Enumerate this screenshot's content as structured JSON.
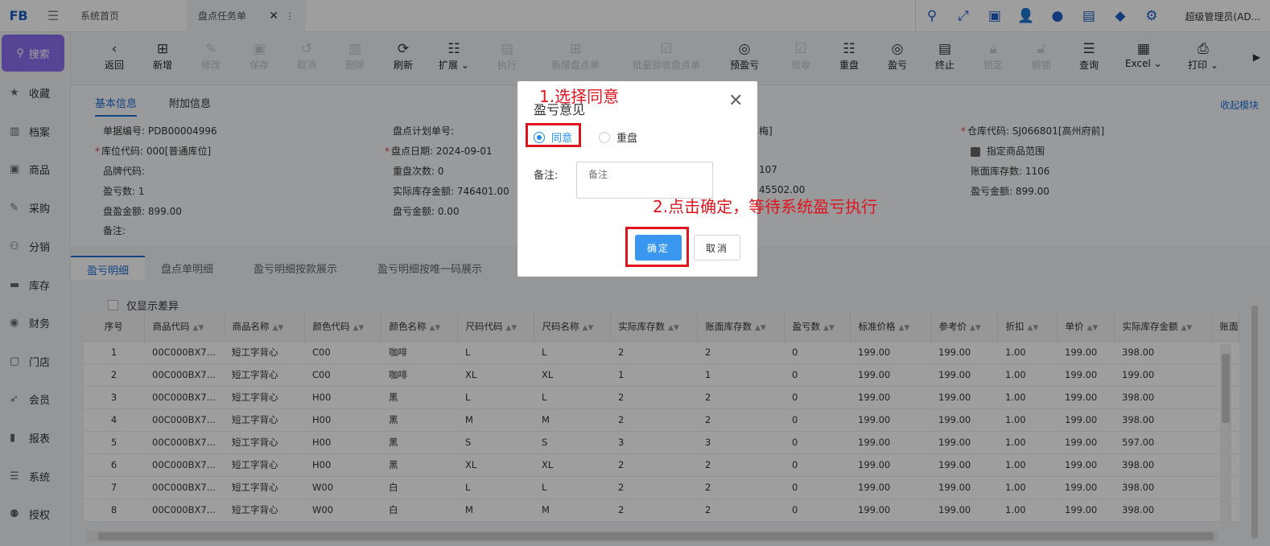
{
  "app": {
    "logo": "FB",
    "tabs": [
      {
        "label": "系统首页"
      },
      {
        "label": "盘点任务单"
      }
    ],
    "user": "超级管理员(AD..."
  },
  "sidebar": {
    "search_label": "搜索",
    "items": [
      {
        "label": "收藏",
        "icon": "star-icon"
      },
      {
        "label": "档案",
        "icon": "archive-icon"
      },
      {
        "label": "商品",
        "icon": "goods-icon"
      },
      {
        "label": "采购",
        "icon": "purchase-icon"
      },
      {
        "label": "分销",
        "icon": "distribution-icon"
      },
      {
        "label": "库存",
        "icon": "inventory-icon"
      },
      {
        "label": "财务",
        "icon": "finance-icon"
      },
      {
        "label": "门店",
        "icon": "store-icon"
      },
      {
        "label": "会员",
        "icon": "member-icon"
      },
      {
        "label": "报表",
        "icon": "report-icon"
      },
      {
        "label": "系统",
        "icon": "system-icon"
      },
      {
        "label": "授权",
        "icon": "license-icon"
      }
    ]
  },
  "toolbar": {
    "buttons": [
      {
        "label": "返回",
        "icon": "back-icon",
        "enabled": true
      },
      {
        "label": "新增",
        "icon": "add-icon",
        "enabled": true
      },
      {
        "label": "修改",
        "icon": "edit-icon",
        "enabled": false
      },
      {
        "label": "保存",
        "icon": "save-icon",
        "enabled": false
      },
      {
        "label": "取消",
        "icon": "undo-icon",
        "enabled": false
      },
      {
        "label": "删除",
        "icon": "delete-icon",
        "enabled": false
      },
      {
        "label": "刷新",
        "icon": "refresh-icon",
        "enabled": true
      },
      {
        "label": "扩展",
        "icon": "extend-icon",
        "enabled": true
      },
      {
        "label": "执行",
        "icon": "execute-icon",
        "enabled": false
      },
      {
        "label": "新增盘点单",
        "icon": "add-count-icon",
        "enabled": false
      },
      {
        "label": "批量验收盘点单",
        "icon": "batch-check-icon",
        "enabled": false
      },
      {
        "label": "预盈亏",
        "icon": "pre-profit-icon",
        "enabled": true
      },
      {
        "label": "验收",
        "icon": "accept-icon",
        "enabled": false
      },
      {
        "label": "重盘",
        "icon": "recount-icon",
        "enabled": true
      },
      {
        "label": "盈亏",
        "icon": "profit-loss-icon",
        "enabled": true
      },
      {
        "label": "终止",
        "icon": "terminate-icon",
        "enabled": true
      },
      {
        "label": "锁定",
        "icon": "lock-icon",
        "enabled": false
      },
      {
        "label": "解锁",
        "icon": "unlock-icon",
        "enabled": false
      },
      {
        "label": "查询",
        "icon": "query-icon",
        "enabled": true
      },
      {
        "label": "Excel",
        "icon": "excel-icon",
        "enabled": true
      },
      {
        "label": "打印",
        "icon": "print-icon",
        "enabled": true
      }
    ]
  },
  "form": {
    "tabs": [
      "基本信息",
      "附加信息"
    ],
    "collapse_label": "收起模块",
    "fields": {
      "doc_no": "单据编号:  PDB00004996",
      "plan_no": "盘点计划单号:",
      "col3_row1": "梅]",
      "warehouse": "仓库代码:  SJ066801[高州府前]",
      "location": "库位代码:  000[普通库位]",
      "count_date": "盘点日期:  2024-09-01",
      "specify_range": "指定商品范围",
      "brand": "品牌代码:",
      "recount_times": "重盘次数:  0",
      "col3_row3": "107",
      "book_qty": "账面库存数:  1106",
      "pl_qty": "盈亏数:  1",
      "actual_amount": "实际库存金额:  746401.00",
      "col3_row4": "45502.00",
      "pl_amount_right": "盈亏金额:  899.00",
      "surplus_amount": "盘盈金额:  899.00",
      "pl_amount_mid": "盘亏金额:  0.00",
      "remark": "备注:"
    }
  },
  "detail": {
    "tabs": [
      "盈亏明细",
      "盘点单明细",
      "盈亏明细按款展示",
      "盈亏明细按唯一码展示"
    ],
    "diff_only_label": "仅显示差异",
    "columns": [
      "序号",
      "商品代码",
      "商品名称",
      "颜色代码",
      "颜色名称",
      "尺码代码",
      "尺码名称",
      "实际库存数",
      "账面库存数",
      "盈亏数",
      "标准价格",
      "参考价",
      "折扣",
      "单价",
      "实际库存金额",
      "账面"
    ],
    "rows": [
      [
        "1",
        "00C000BX7...",
        "短工字背心",
        "C00",
        "咖啡",
        "L",
        "L",
        "2",
        "2",
        "0",
        "199.00",
        "199.00",
        "1.00",
        "199.00",
        "398.00"
      ],
      [
        "2",
        "00C000BX7...",
        "短工字背心",
        "C00",
        "咖啡",
        "XL",
        "XL",
        "1",
        "1",
        "0",
        "199.00",
        "199.00",
        "1.00",
        "199.00",
        "199.00"
      ],
      [
        "3",
        "00C000BX7...",
        "短工字背心",
        "H00",
        "黑",
        "L",
        "L",
        "2",
        "2",
        "0",
        "199.00",
        "199.00",
        "1.00",
        "199.00",
        "398.00"
      ],
      [
        "4",
        "00C000BX7...",
        "短工字背心",
        "H00",
        "黑",
        "M",
        "M",
        "2",
        "2",
        "0",
        "199.00",
        "199.00",
        "1.00",
        "199.00",
        "398.00"
      ],
      [
        "5",
        "00C000BX7...",
        "短工字背心",
        "H00",
        "黑",
        "S",
        "S",
        "3",
        "3",
        "0",
        "199.00",
        "199.00",
        "1.00",
        "199.00",
        "597.00"
      ],
      [
        "6",
        "00C000BX7...",
        "短工字背心",
        "H00",
        "黑",
        "XL",
        "XL",
        "2",
        "2",
        "0",
        "199.00",
        "199.00",
        "1.00",
        "199.00",
        "398.00"
      ],
      [
        "7",
        "00C000BX7...",
        "短工字背心",
        "W00",
        "白",
        "L",
        "L",
        "2",
        "2",
        "0",
        "199.00",
        "199.00",
        "1.00",
        "199.00",
        "398.00"
      ],
      [
        "8",
        "00C000BX7...",
        "短工字背心",
        "W00",
        "白",
        "M",
        "M",
        "2",
        "2",
        "0",
        "199.00",
        "199.00",
        "1.00",
        "199.00",
        "398.00"
      ]
    ]
  },
  "dialog": {
    "title": "盈亏意见",
    "option_agree": "同意",
    "option_recount": "重盘",
    "selected": "同意",
    "remark_label": "备注:",
    "remark_placeholder": "备注",
    "ok_label": "确定",
    "cancel_label": "取消"
  },
  "annotations": {
    "step1": "1.选择同意",
    "step2": "2.点击确定，等待系统盈亏执行"
  },
  "colors": {
    "accent": "#1f6fd6",
    "search_button": "#8c6ef0",
    "ok_button": "#3a97f0",
    "highlight": "#e0141e"
  }
}
